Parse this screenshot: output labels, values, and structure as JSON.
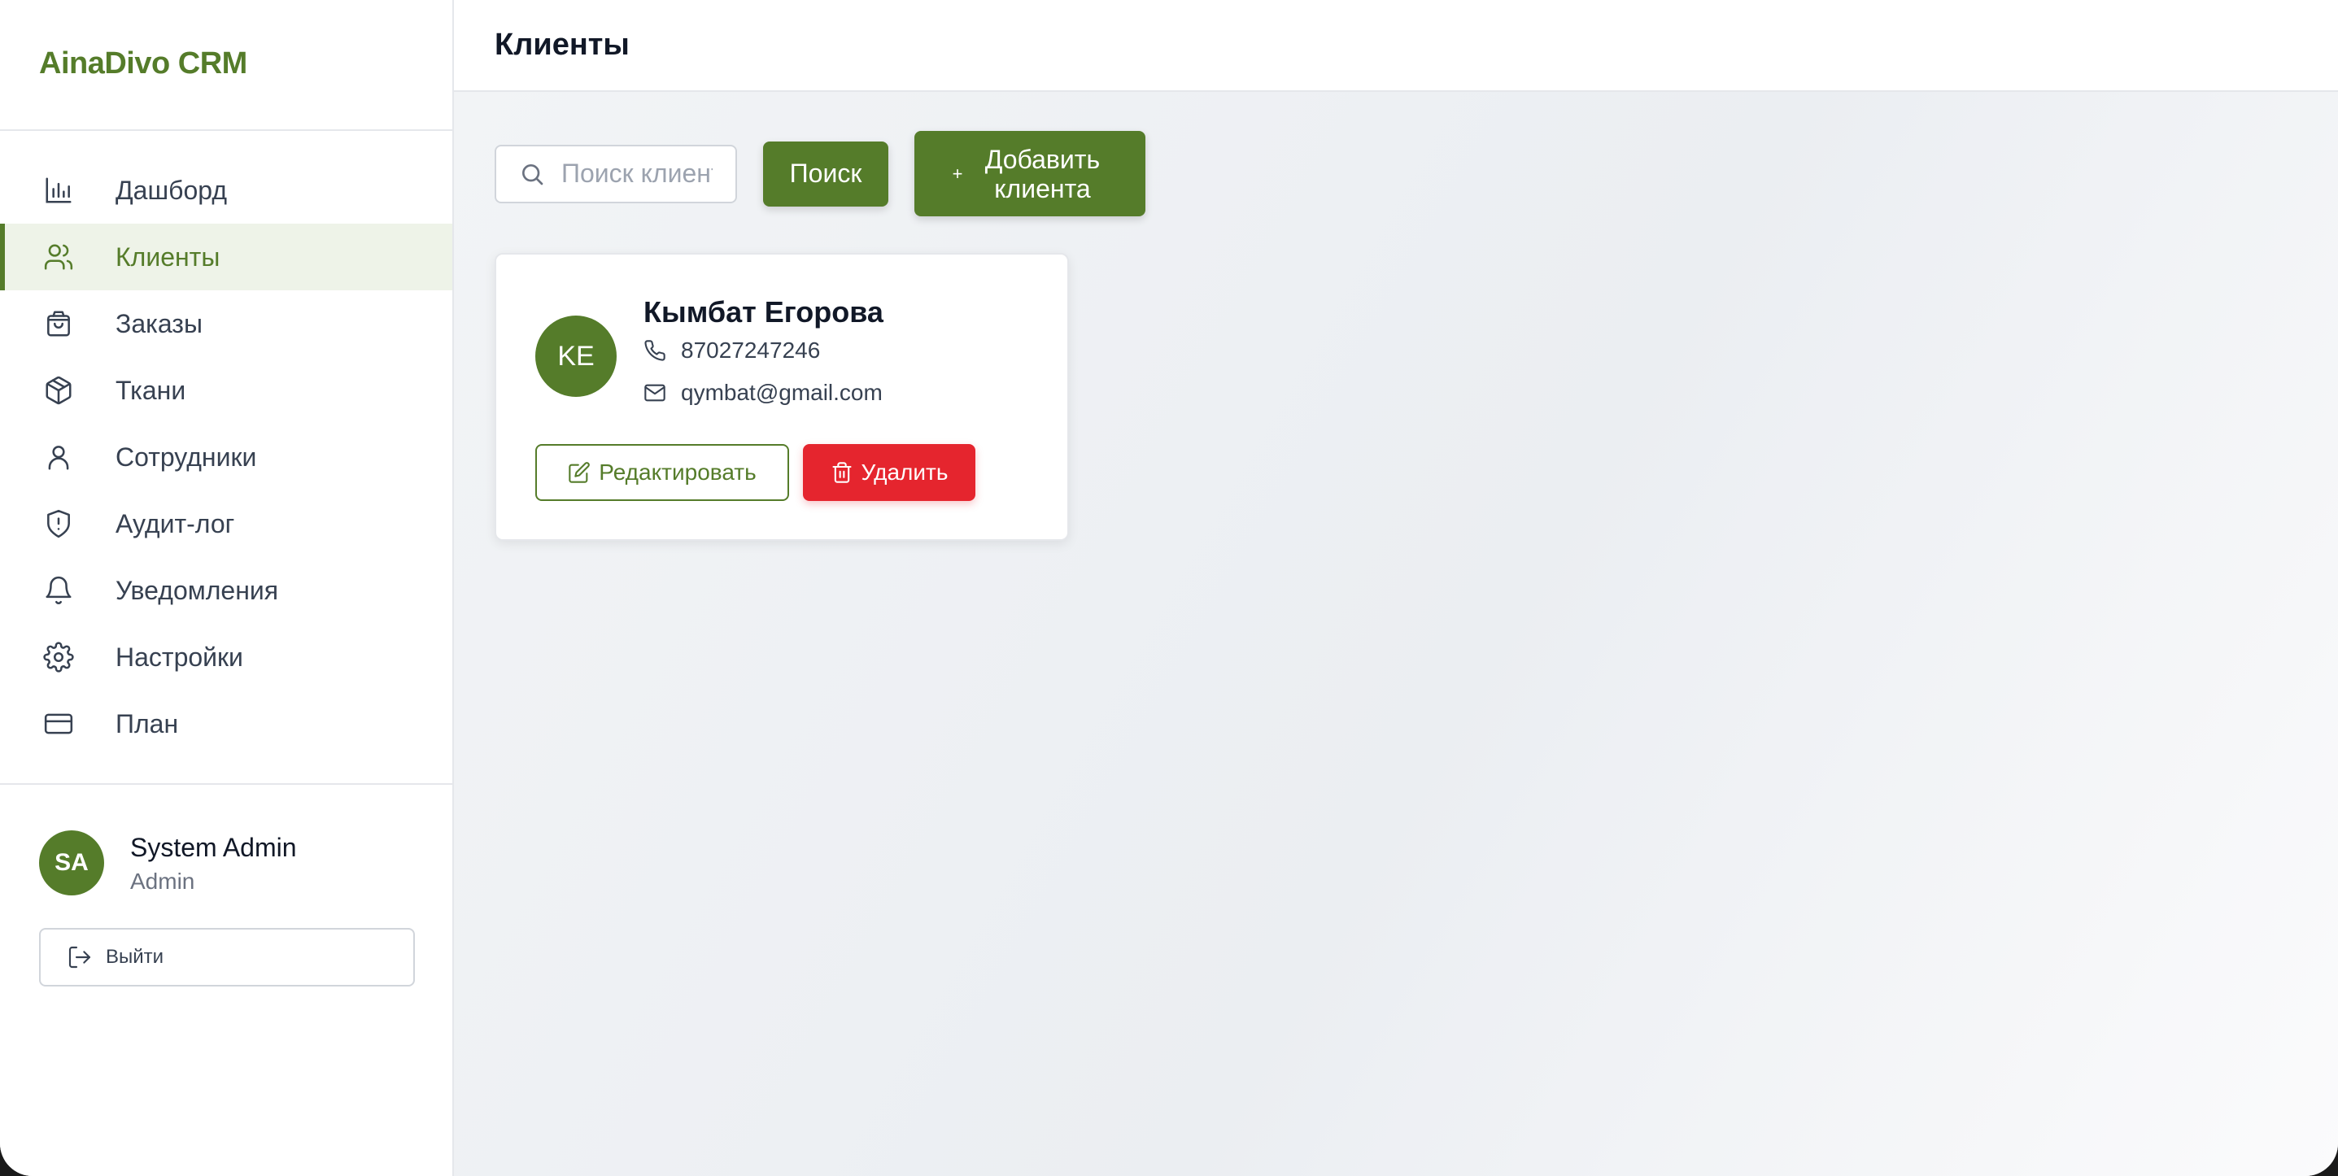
{
  "app": {
    "logo": "AinaDivo CRM"
  },
  "sidebar": {
    "items": [
      {
        "label": "Дашборд",
        "icon": "bar-chart-icon"
      },
      {
        "label": "Клиенты",
        "icon": "users-icon",
        "active": true
      },
      {
        "label": "Заказы",
        "icon": "shopping-bag-icon"
      },
      {
        "label": "Ткани",
        "icon": "package-icon"
      },
      {
        "label": "Сотрудники",
        "icon": "user-icon"
      },
      {
        "label": "Аудит-лог",
        "icon": "shield-alert-icon"
      },
      {
        "label": "Уведомления",
        "icon": "bell-icon"
      },
      {
        "label": "Настройки",
        "icon": "gear-icon"
      },
      {
        "label": "План",
        "icon": "credit-card-icon"
      }
    ],
    "user": {
      "initials": "SA",
      "name": "System Admin",
      "role": "Admin"
    },
    "logout_label": "Выйти"
  },
  "header": {
    "title": "Клиенты"
  },
  "toolbar": {
    "search_placeholder": "Поиск клиентов",
    "search_label": "Поиск",
    "add_plus": "+",
    "add_label": "Добавить клиента"
  },
  "clients": [
    {
      "initials": "KE",
      "name": "Кымбат Егорова",
      "phone": "87027247246",
      "email": "qymbat@gmail.com",
      "edit_label": "Редактировать",
      "delete_label": "Удалить"
    }
  ],
  "colors": {
    "brand": "#557c2a",
    "danger": "#e5252e",
    "active_bg": "#eef3e8"
  }
}
